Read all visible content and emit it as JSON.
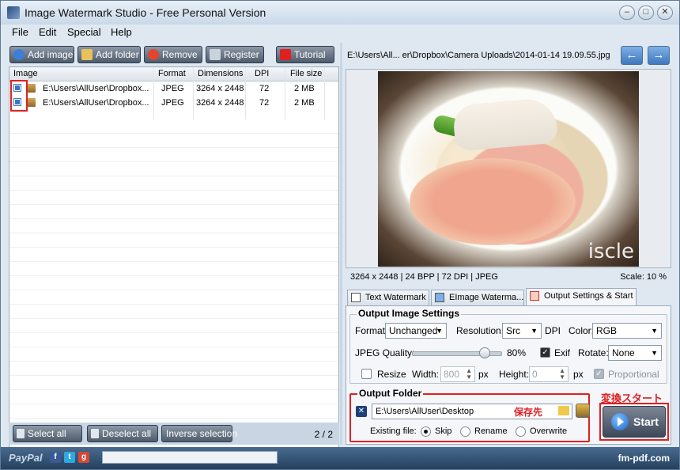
{
  "window": {
    "title": "Image Watermark Studio - Free Personal Version",
    "min_label": "–",
    "max_label": "□",
    "close_label": "✕"
  },
  "menu": [
    "File",
    "Edit",
    "Special",
    "Help"
  ],
  "toolbar": {
    "add_image": "Add image",
    "add_folder": "Add folder",
    "remove": "Remove",
    "register": "Register",
    "tutorial": "Tutorial"
  },
  "grid": {
    "columns": [
      "Image",
      "Format",
      "Dimensions",
      "DPI",
      "File size"
    ],
    "rows": [
      {
        "image": "E:\\Users\\AllUser\\Dropbox...",
        "format": "JPEG",
        "dimensions": "3264 x 2448",
        "dpi": "72",
        "size": "2 MB",
        "checked": true
      },
      {
        "image": "E:\\Users\\AllUser\\Dropbox...",
        "format": "JPEG",
        "dimensions": "3264 x 2448",
        "dpi": "72",
        "size": "2 MB",
        "checked": true
      }
    ]
  },
  "bottom": {
    "select_all": "Select all",
    "deselect_all": "Deselect all",
    "inverse": "Inverse selection",
    "count": "2 / 2"
  },
  "preview": {
    "path": "E:\\Users\\All... er\\Dropbox\\Camera Uploads\\2014-01-14 19.09.55.jpg",
    "watermark_text": "iscle",
    "info": "3264 x 2448  |  24 BPP  |  72 DPI  |  JPEG",
    "scale": "Scale: 10 %"
  },
  "tabs": [
    "Text Watermark",
    "EImage Waterma...",
    "Output Settings & Start"
  ],
  "output_image": {
    "group_title": "Output Image Settings",
    "format_label": "Format:",
    "format_value": "Unchanged",
    "resolution_label": "Resolution:",
    "resolution_value": "Src",
    "dpi_label": "DPI",
    "color_label": "Color:",
    "color_value": "RGB",
    "jpeg_label": "JPEG Quality:",
    "jpeg_value": "80%",
    "jpeg_quality": 0.8,
    "exif_label": "Exif",
    "rotate_label": "Rotate:",
    "rotate_value": "None",
    "resize_label": "Resize",
    "width_label": "Width:",
    "width_value": "800",
    "px": "px",
    "height_label": "Height:",
    "height_value": "0",
    "proportional_label": "Proportional"
  },
  "output_folder": {
    "group_title": "Output Folder",
    "path": "E:\\Users\\AllUser\\Desktop",
    "note_jp": "保存先",
    "existing_label": "Existing file:",
    "skip": "Skip",
    "rename": "Rename",
    "overwrite": "Overwrite"
  },
  "start": {
    "note_jp": "変換スタート",
    "label": "Start"
  },
  "status": {
    "paypal": "PayPal",
    "site": "fm-pdf.com"
  },
  "colors": {
    "highlight_red": "#e02020",
    "start_blue": "#1d63c9"
  }
}
